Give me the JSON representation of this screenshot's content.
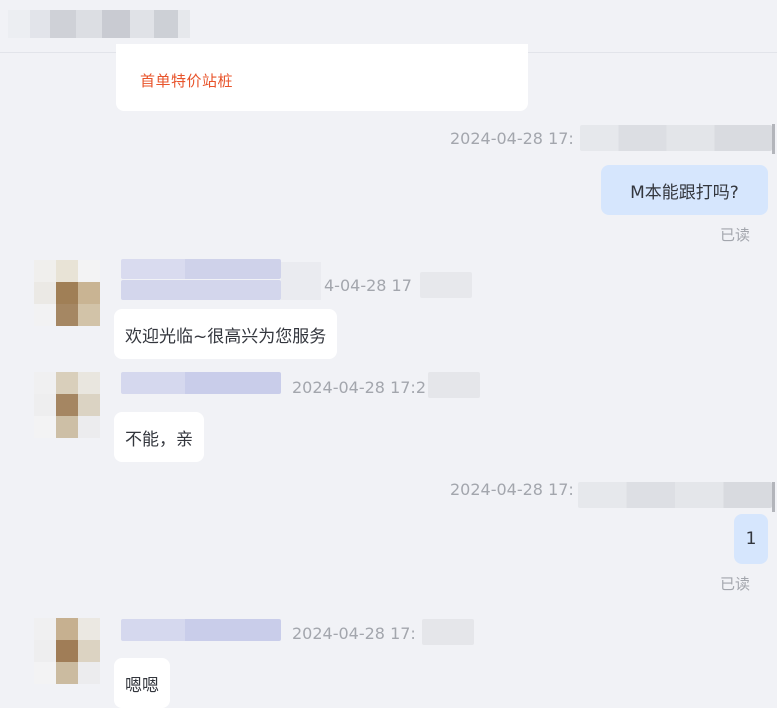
{
  "header": {
    "contact_name": ""
  },
  "card": {
    "link_text": "首单特价站桩"
  },
  "messages": [
    {
      "id": "m1",
      "direction": "out",
      "timestamp": "2024-04-28 17:",
      "text": "M本能跟打吗?",
      "status": "已读"
    },
    {
      "id": "m2",
      "direction": "in",
      "timestamp": "4-04-28 17",
      "text": "欢迎光临~很高兴为您服务"
    },
    {
      "id": "m3",
      "direction": "in",
      "timestamp": "2024-04-28 17:2",
      "text": "不能，亲"
    },
    {
      "id": "m4",
      "direction": "out",
      "timestamp": "2024-04-28 17:",
      "text": "1",
      "status": "已读"
    },
    {
      "id": "m5",
      "direction": "in",
      "timestamp": "2024-04-28 17:",
      "text": "嗯嗯"
    }
  ],
  "colors": {
    "background": "#f1f2f6",
    "outgoing_bubble": "#d6e6fd",
    "incoming_bubble": "#ffffff",
    "link_orange": "#e8542b",
    "meta_gray": "#a3a6ad"
  }
}
